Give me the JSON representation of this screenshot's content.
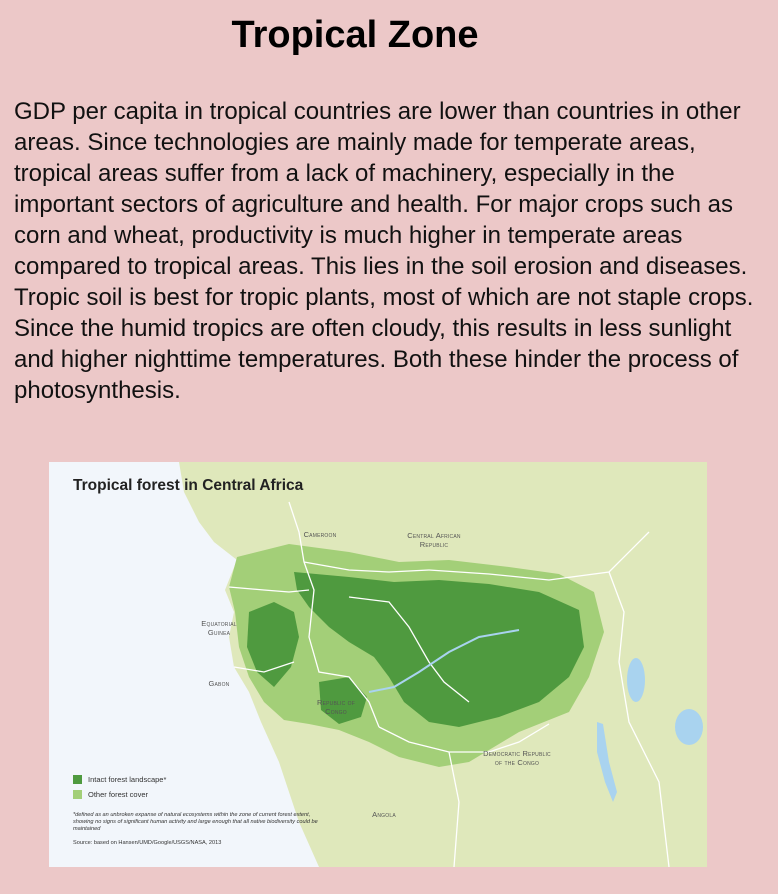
{
  "slide": {
    "title": "Tropical Zone",
    "body": "GDP per capita in tropical countries are lower than countries in other areas. Since technologies are mainly made for temperate areas, tropical areas suffer from a lack of machinery, especially in the important sectors of agriculture and health. For major crops such as corn and wheat, productivity is much higher in temperate areas compared to tropical areas. This lies in the soil erosion and diseases. Tropic soil is best for tropic plants, most of which are not staple crops. Since the humid tropics are often cloudy, this results in less sunlight and higher nighttime temperatures. Both these hinder the process of photosynthesis."
  },
  "map": {
    "title": "Tropical forest in Central Africa",
    "labels": {
      "cameroon": "Cameroon",
      "car": "Central African Republic",
      "eq_guinea": "Equatorial Guinea",
      "gabon": "Gabon",
      "rep_congo": "Republic of Congo",
      "drc": "Democratic Republic of the Congo",
      "angola": "Angola"
    },
    "legend": [
      {
        "label": "Intact forest landscape*",
        "color": "#4f9a3f"
      },
      {
        "label": "Other forest cover",
        "color": "#a3cf78"
      }
    ],
    "footnote": "*defined as an unbroken expanse of natural ecosystems within the zone of current forest extent, showing no signs of significant human activity and large enough that all native biodiversity could be maintained",
    "source": "Source: based on Hansen/UMD/Google/USGS/NASA, 2013",
    "colors": {
      "ocean": "#f2f6fb",
      "land": "#dfe8bb",
      "other_forest": "#a3cf78",
      "intact_forest": "#4f9a3f",
      "water": "#a9d3ef",
      "border": "#ffffff"
    }
  }
}
